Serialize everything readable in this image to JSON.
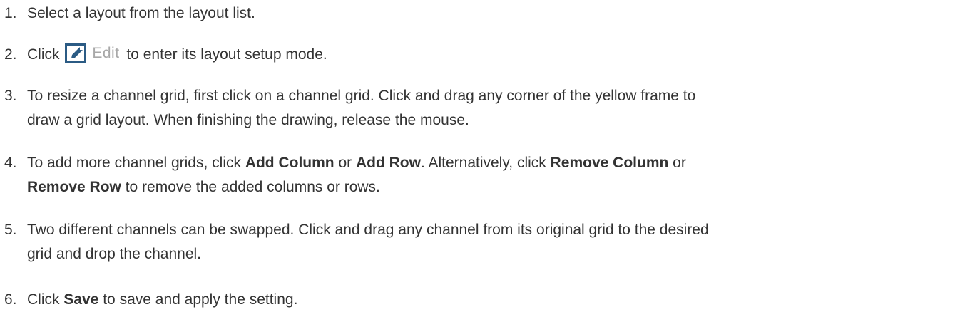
{
  "steps": [
    {
      "number": "1.",
      "parts": [
        "Select a layout from the layout list."
      ]
    },
    {
      "number": "2.",
      "before": "Click ",
      "edit_label": "Edit",
      "after": " to enter its layout setup mode."
    },
    {
      "number": "3.",
      "line1": "To resize a channel grid, first click on a channel grid. Click and drag any corner of the yellow frame to",
      "line2": "draw a grid layout. When finishing the drawing, release the mouse."
    },
    {
      "number": "4.",
      "t1": "To add more channel grids, click ",
      "b1": "Add Column",
      "t2": " or ",
      "b2": "Add Row",
      "t3": ". Alternatively, click ",
      "b3": "Remove Column",
      "t4": " or",
      "b4": "Remove Row",
      "t5": " to remove the added columns or rows."
    },
    {
      "number": "5.",
      "line1": "Two different channels can be swapped. Click and drag any channel from its original grid to the desired",
      "line2": "grid and drop the channel."
    },
    {
      "number": "6.",
      "t1": "Click ",
      "b1": "Save",
      "t2": " to save and apply the setting."
    }
  ],
  "icons": {
    "edit": "edit-pencil-icon",
    "edit_color": "#2b5b84"
  }
}
